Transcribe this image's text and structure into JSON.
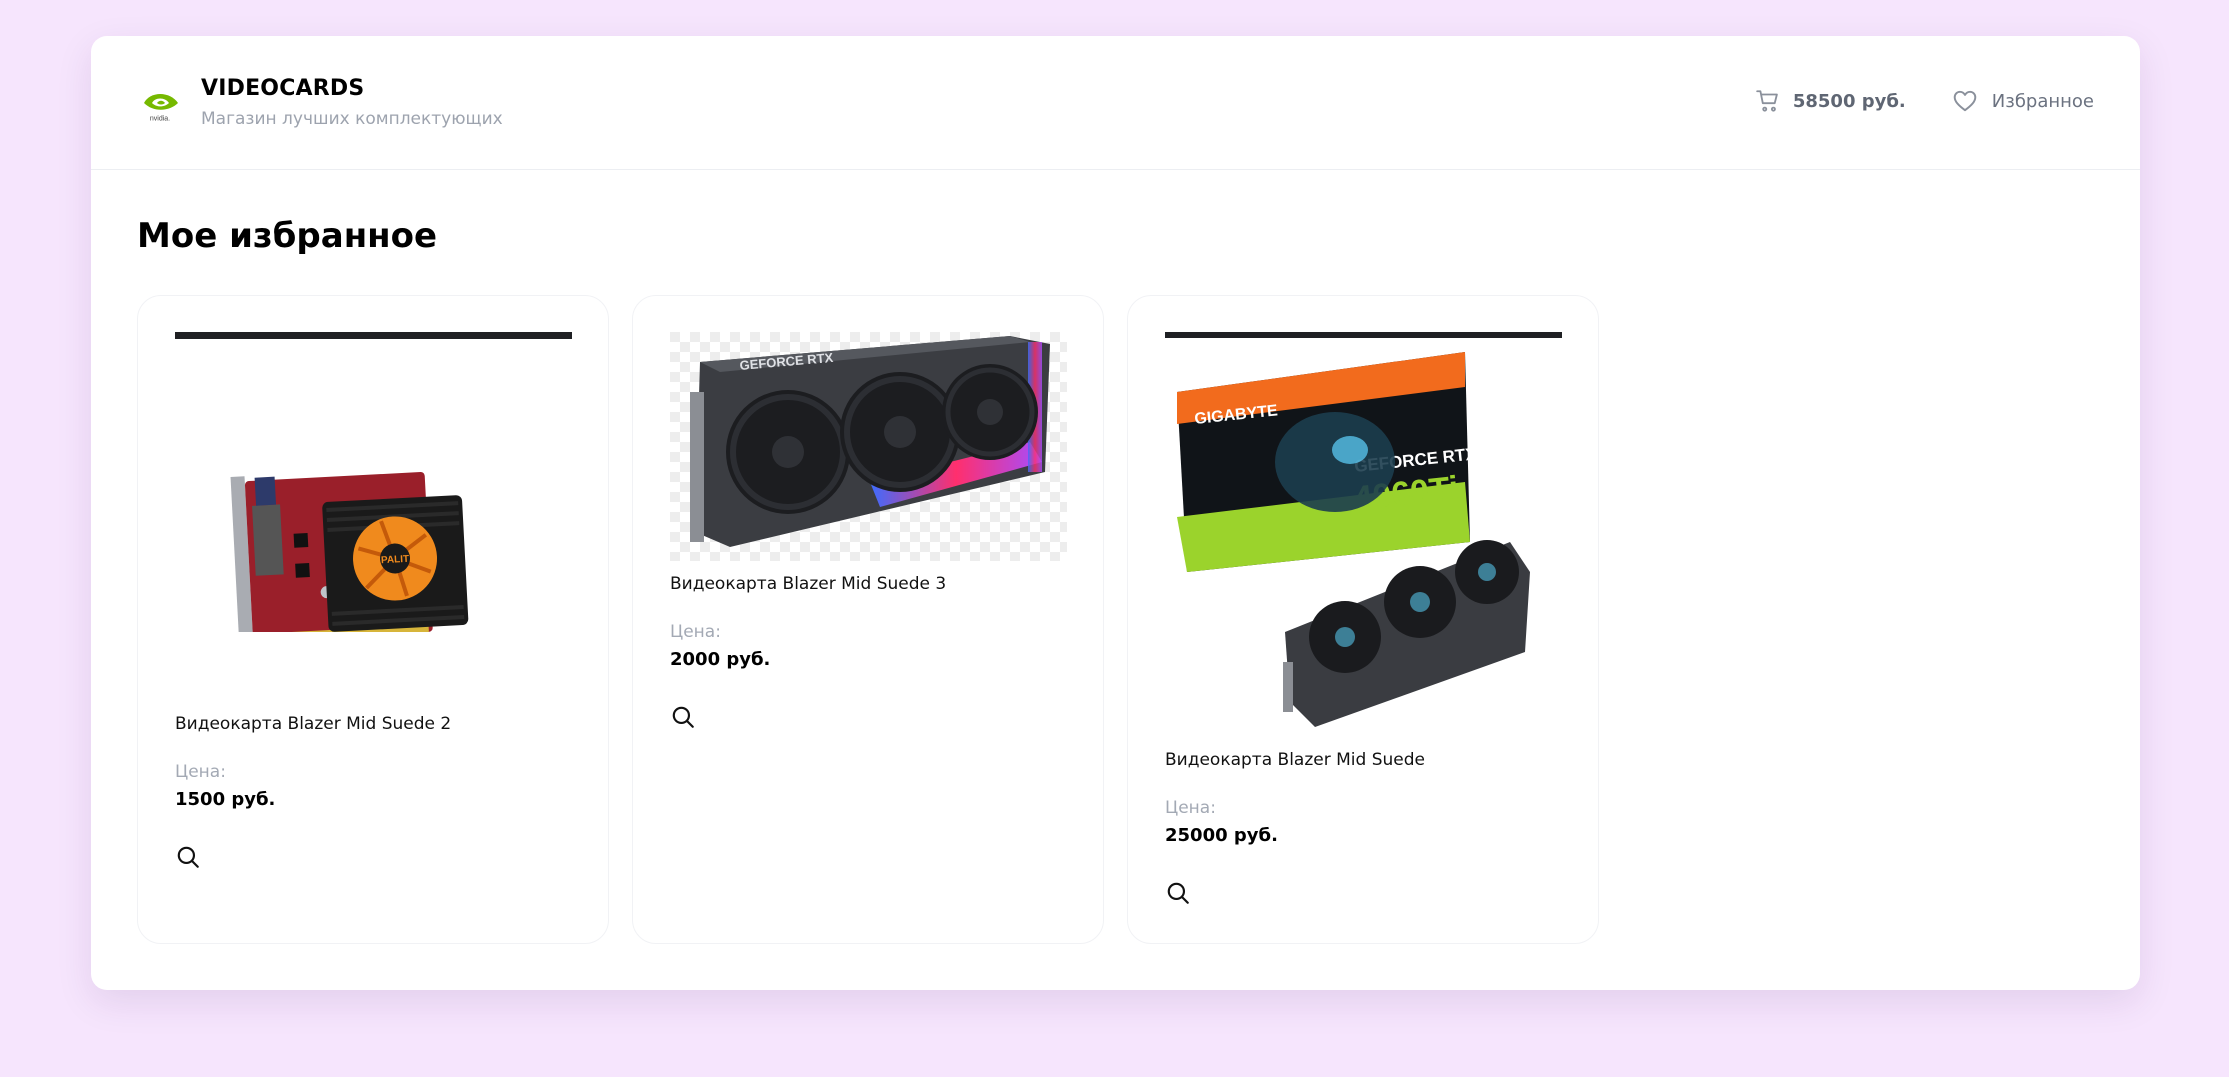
{
  "header": {
    "title": "VIDEOCARDS",
    "subtitle": "Магазин лучших комплектующих",
    "logo_icon": "nvidia-logo",
    "cart_total": "58500 руб.",
    "favorites_label": "Избранное"
  },
  "page": {
    "title": "Мое избранное"
  },
  "products": [
    {
      "name": "Видеокарта Blazer Mid Suede 2",
      "price_label": "Цена:",
      "price": "1500 руб.",
      "image": "graphics-card-red-small"
    },
    {
      "name": "Видеокарта Blazer Mid Suede 3",
      "price_label": "Цена:",
      "price": "2000 руб.",
      "image": "graphics-card-geforce-rtx-rog"
    },
    {
      "name": "Видеокарта Blazer Mid Suede",
      "price_label": "Цена:",
      "price": "25000 руб.",
      "image": "graphics-card-gigabyte-rtx-4060ti-box"
    }
  ],
  "colors": {
    "background": "#f6e5fd",
    "card": "#ffffff",
    "muted_text": "#9da3ae"
  }
}
